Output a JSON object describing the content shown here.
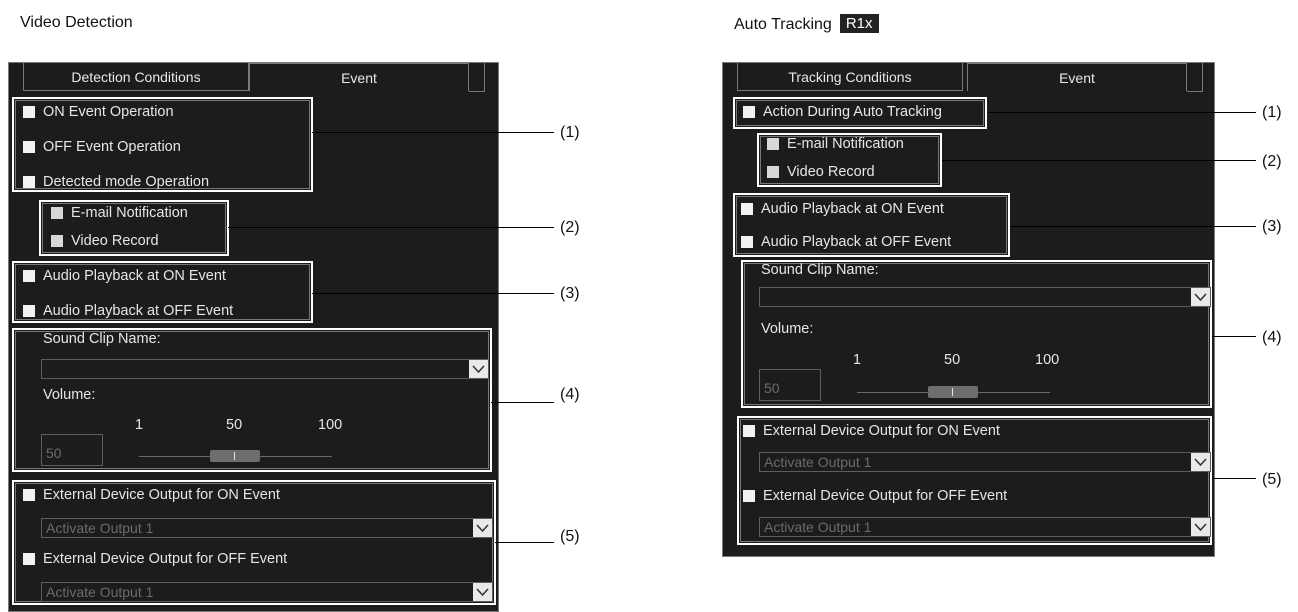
{
  "left": {
    "heading": "Video Detection",
    "tabs": [
      "Detection Conditions",
      "Event"
    ],
    "checks": {
      "on_event": "ON Event Operation",
      "off_event": "OFF Event Operation",
      "detected_mode": "Detected mode Operation",
      "email": "E-mail Notification",
      "video_record": "Video Record",
      "audio_on": "Audio Playback at ON Event",
      "audio_off": "Audio Playback at OFF Event",
      "ext_on": "External Device Output for ON Event",
      "ext_off": "External Device Output for OFF Event"
    },
    "sound_clip_label": "Sound Clip Name:",
    "sound_clip_value": "",
    "volume_label": "Volume:",
    "volume_ticks": [
      "1",
      "50",
      "100"
    ],
    "volume_value": "50",
    "volume_level": 50,
    "ext_on_select": "Activate Output 1",
    "ext_off_select": "Activate Output 1"
  },
  "right": {
    "heading": "Auto Tracking",
    "badge": "R1x",
    "tabs": [
      "Tracking Conditions",
      "Event"
    ],
    "checks": {
      "action": "Action During Auto Tracking",
      "email": "E-mail Notification",
      "video_record": "Video Record",
      "audio_on": "Audio Playback at ON Event",
      "audio_off": "Audio Playback at OFF Event",
      "ext_on": "External Device Output for ON Event",
      "ext_off": "External Device Output for OFF Event"
    },
    "sound_clip_label": "Sound Clip Name:",
    "sound_clip_value": "",
    "volume_label": "Volume:",
    "volume_ticks": [
      "1",
      "50",
      "100"
    ],
    "volume_value": "50",
    "volume_level": 50,
    "ext_on_select": "Activate Output 1",
    "ext_off_select": "Activate Output 1"
  },
  "callouts": [
    "(1)",
    "(2)",
    "(3)",
    "(4)",
    "(5)"
  ],
  "colors": {
    "panel_bg": "#1c1c1c",
    "highlight_box": "#ffffff"
  },
  "icons": {
    "dropdown": "chevron-down-icon"
  }
}
